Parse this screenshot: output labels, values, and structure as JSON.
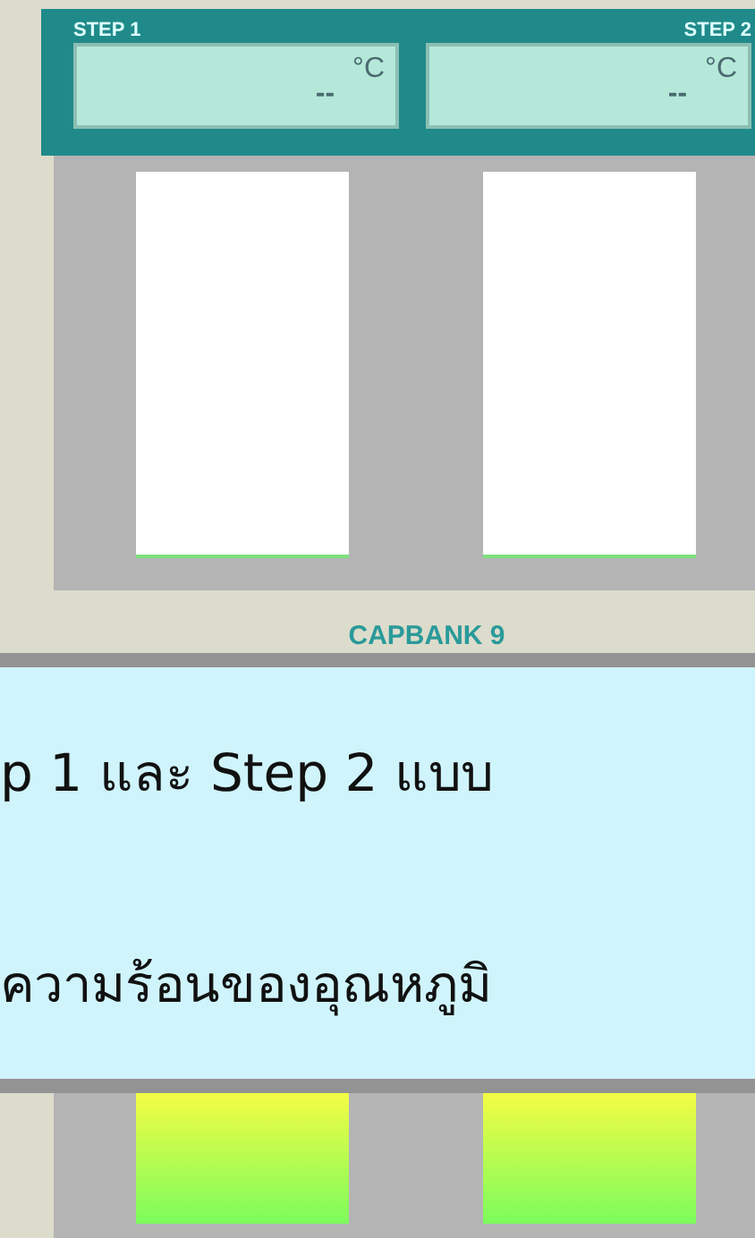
{
  "steps": [
    {
      "label": "STEP 1",
      "reading": "--",
      "unit": "°C"
    },
    {
      "label": "STEP 2",
      "reading": "--",
      "unit": "°C"
    }
  ],
  "caption": "CAPBANK 9",
  "banner": {
    "lines": [
      "p 1 และ Step 2 แบบ",
      "ความร้อนของอุณหภูมิ"
    ]
  }
}
